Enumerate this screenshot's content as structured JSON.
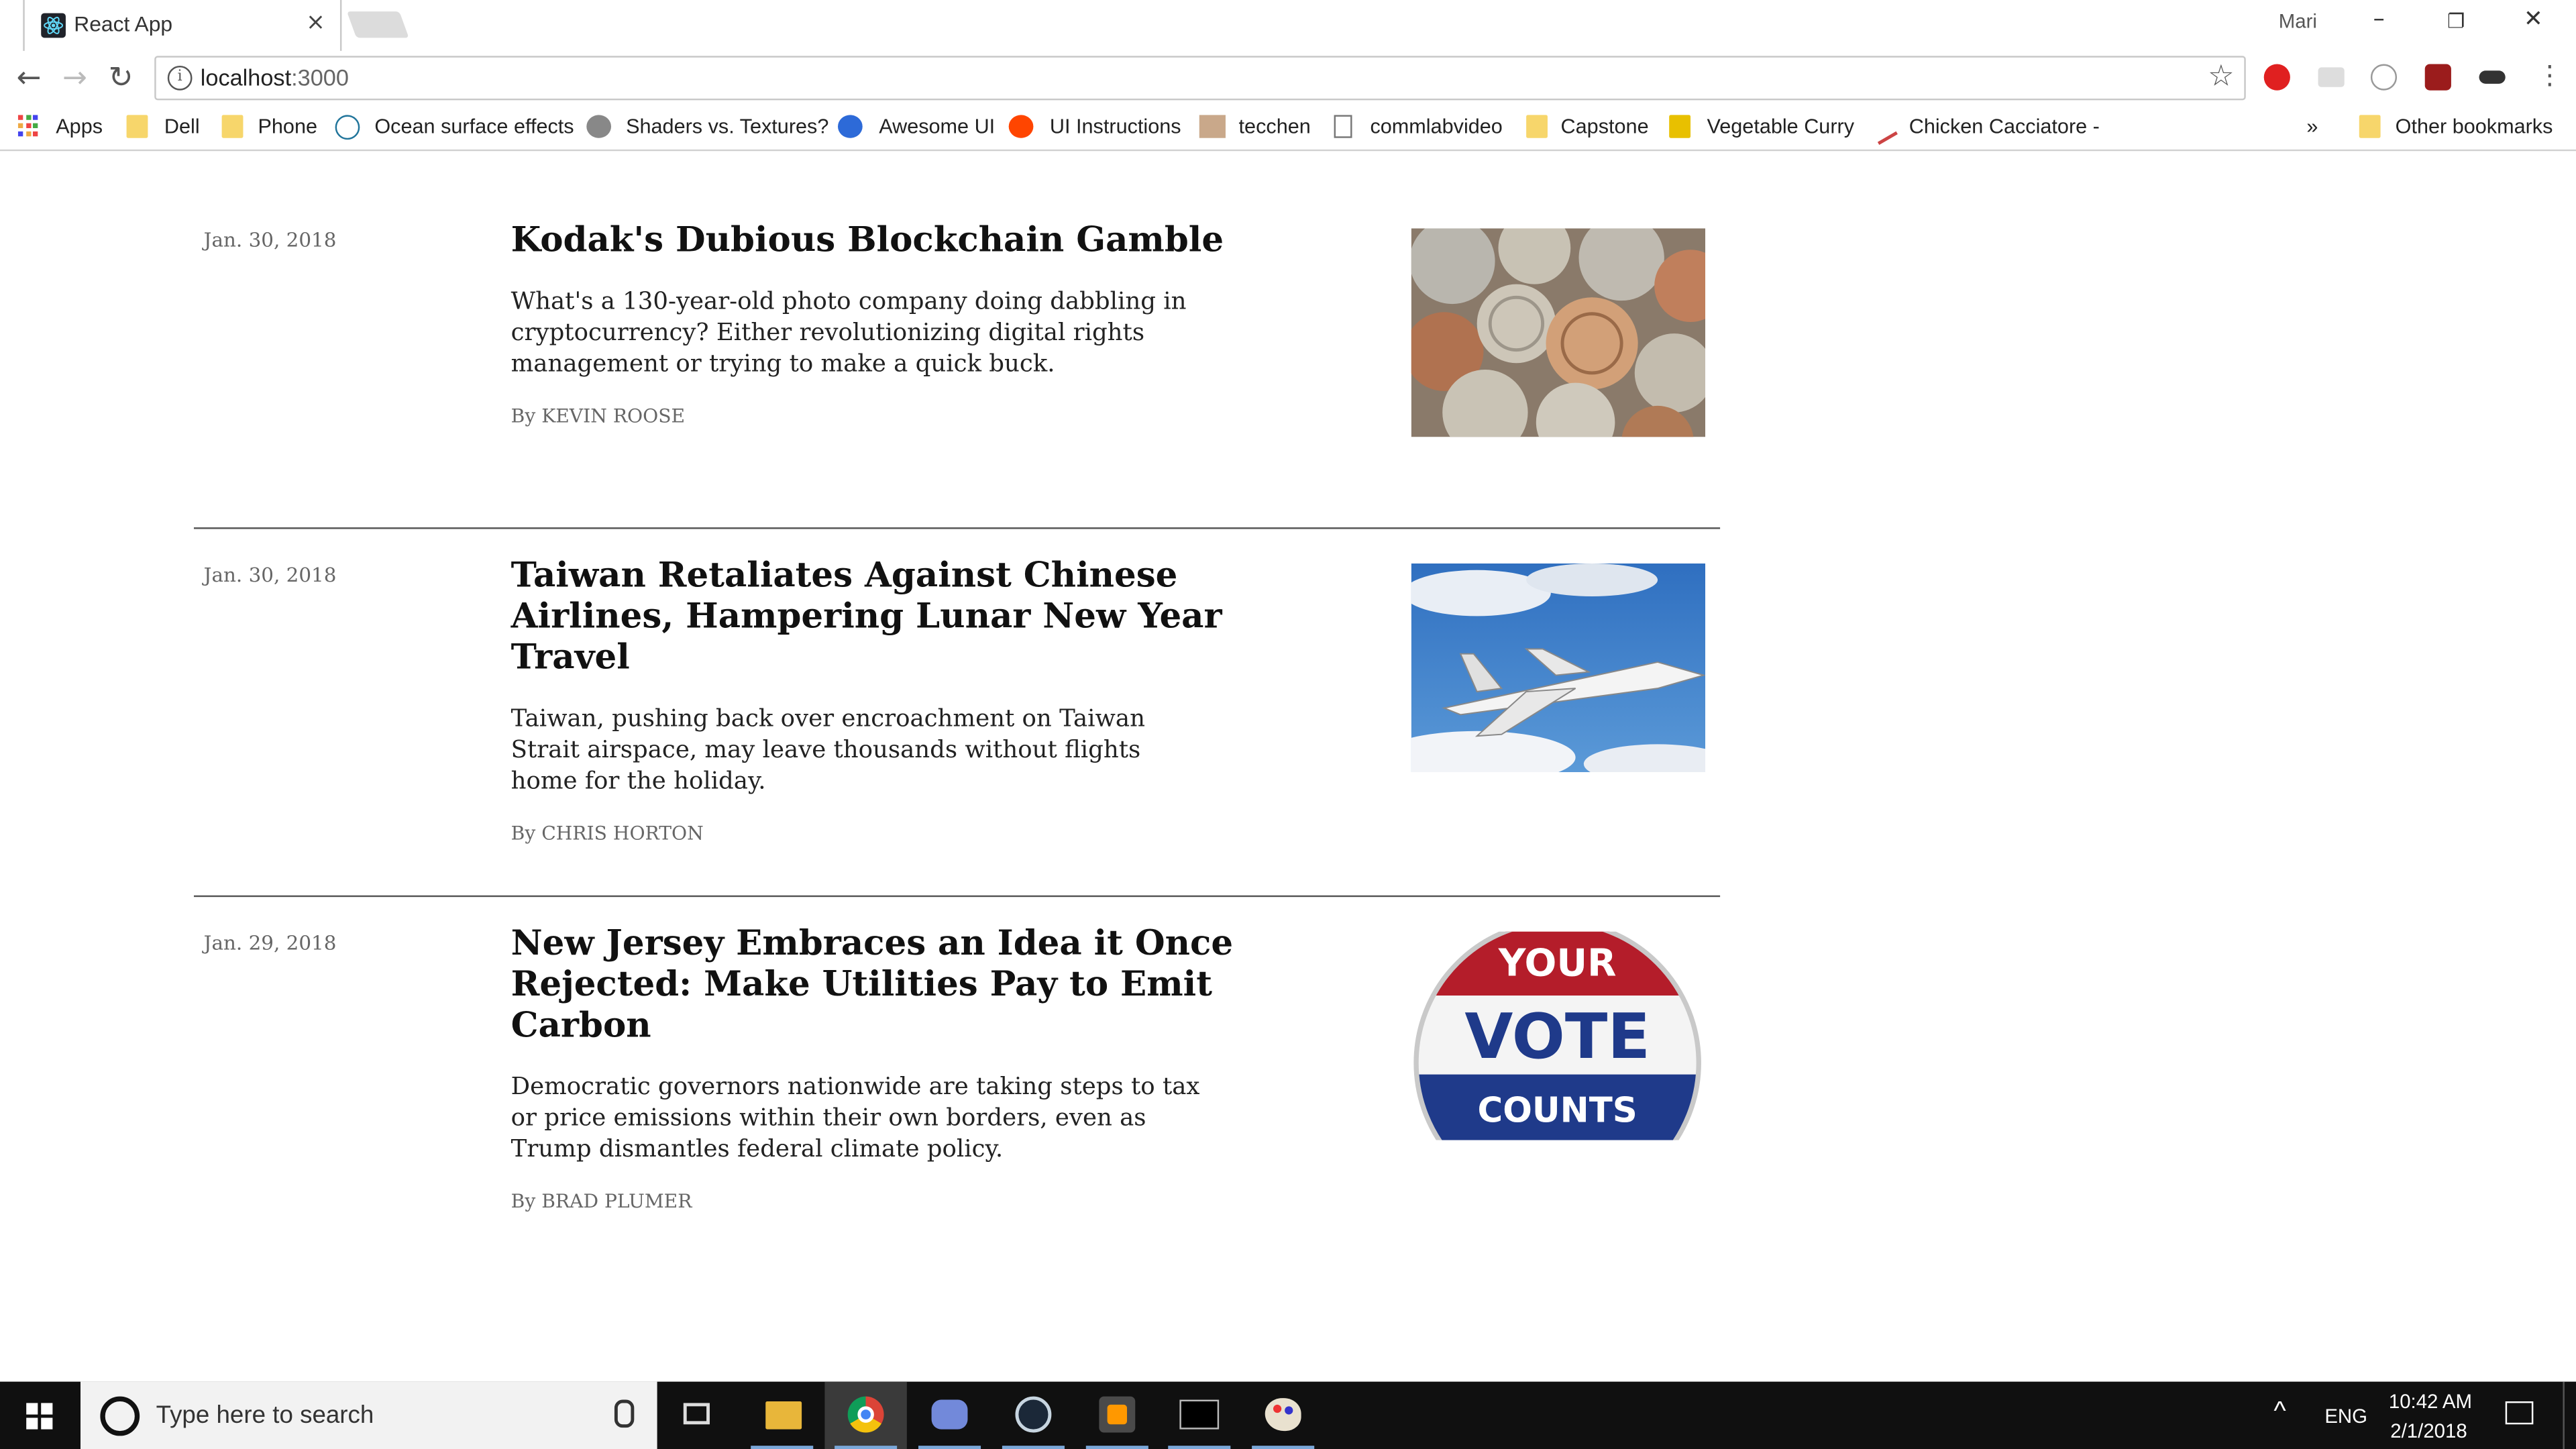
{
  "browser": {
    "tab_title": "React App",
    "tab_close": "×",
    "profile_name": "Mari",
    "url_host": "localhost",
    "url_port": ":3000"
  },
  "bookmarks": [
    {
      "label": "Apps",
      "icon": "apps-grid-icon"
    },
    {
      "label": "Dell",
      "icon": "folder-icon"
    },
    {
      "label": "Phone",
      "icon": "folder-icon"
    },
    {
      "label": "Ocean surface effects",
      "icon": "wordpress-icon"
    },
    {
      "label": "Shaders vs. Textures?",
      "icon": "reddit-icon"
    },
    {
      "label": "Awesome UI",
      "icon": "site-icon"
    },
    {
      "label": "UI Instructions",
      "icon": "reddit-icon"
    },
    {
      "label": "tecchen",
      "icon": "avatar-icon"
    },
    {
      "label": "commlabvideo",
      "icon": "page-icon"
    },
    {
      "label": "Capstone",
      "icon": "folder-icon"
    },
    {
      "label": "Vegetable Curry",
      "icon": "folder-icon"
    },
    {
      "label": "Chicken Cacciatore -",
      "icon": "recipe-icon"
    },
    {
      "label": "»",
      "icon": "overflow"
    },
    {
      "label": "Other bookmarks",
      "icon": "folder-icon"
    }
  ],
  "articles": [
    {
      "date": "Jan. 30, 2018",
      "headline": "Kodak's Dubious Blockchain Gamble",
      "summary": "What's a 130-year-old photo company doing dabbling in cryptocurrency? Either revolutionizing digital rights management or trying to make a quick buck.",
      "byline": "By KEVIN ROOSE",
      "image": "coins-photo"
    },
    {
      "date": "Jan. 30, 2018",
      "headline": "Taiwan Retaliates Against Chinese Airlines, Hampering Lunar New Year Travel",
      "summary": "Taiwan, pushing back over encroachment on Taiwan Strait airspace, may leave thousands without flights home for the holiday.",
      "byline": "By CHRIS HORTON",
      "image": "jet-photo"
    },
    {
      "date": "Jan. 29, 2018",
      "headline": "New Jersey Embraces an Idea it Once Rejected: Make Utilities Pay to Emit Carbon",
      "summary": "Democratic governors nationwide are taking steps to tax or price emissions within their own borders, even as Trump dismantles federal climate policy.",
      "byline": "By BRAD PLUMER",
      "image": "vote-button-photo",
      "image_text": {
        "line1": "YOUR",
        "line2": "VOTE",
        "line3": "COUNTS"
      }
    }
  ],
  "taskbar": {
    "search_placeholder": "Type here to search",
    "language": "ENG",
    "time": "10:42 AM",
    "date": "2/1/2018"
  },
  "colors": {
    "taskbar_bg": "#101010",
    "divider": "#555555",
    "active_app": "#3a3a3a"
  }
}
